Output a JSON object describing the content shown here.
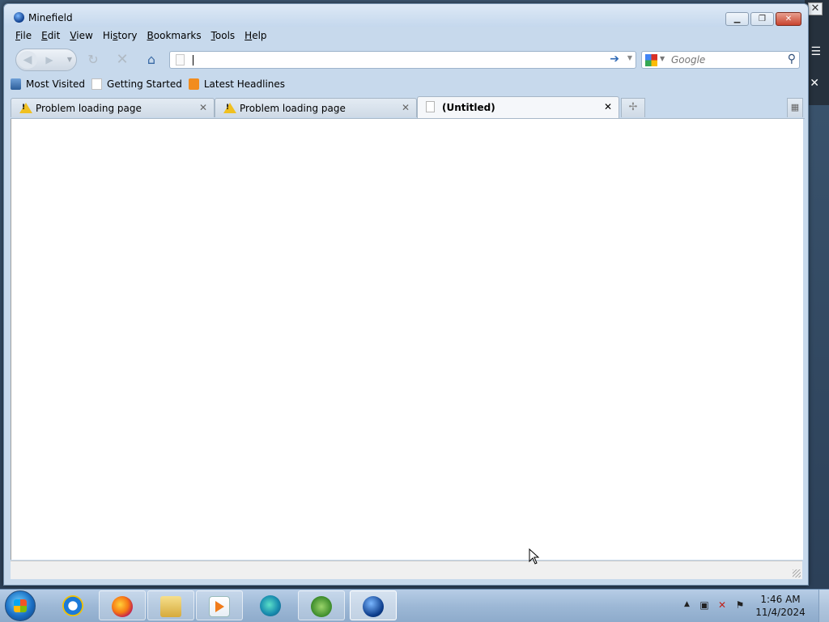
{
  "window": {
    "title": "Minefield"
  },
  "menu": [
    "File",
    "Edit",
    "View",
    "History",
    "Bookmarks",
    "Tools",
    "Help"
  ],
  "menu_access_keys": [
    "F",
    "E",
    "V",
    "H",
    "B",
    "T",
    "H"
  ],
  "navigation": {
    "url_value": "",
    "search_placeholder": "Google"
  },
  "bookmarks": [
    {
      "label": "Most Visited",
      "icon": "most-visited-icon"
    },
    {
      "label": "Getting Started",
      "icon": "page-icon"
    },
    {
      "label": "Latest Headlines",
      "icon": "rss-feed-icon"
    }
  ],
  "tabs": [
    {
      "label": "Problem loading page",
      "icon": "warning-icon",
      "active": false
    },
    {
      "label": "Problem loading page",
      "icon": "warning-icon",
      "active": false
    },
    {
      "label": "(Untitled)",
      "icon": "page-icon",
      "active": true
    }
  ],
  "taskbar": {
    "apps": [
      {
        "name": "internet-explorer",
        "icon": "ie-icon"
      },
      {
        "name": "firefox",
        "icon": "firefox-icon"
      },
      {
        "name": "file-explorer",
        "icon": "folder-icon"
      },
      {
        "name": "media-player",
        "icon": "media-player-icon"
      },
      {
        "name": "edge",
        "icon": "edge-icon"
      },
      {
        "name": "windows",
        "icon": "windows-icon"
      },
      {
        "name": "minefield",
        "icon": "minefield-icon"
      }
    ],
    "clock_time": "1:46 AM",
    "clock_date": "11/4/2024"
  },
  "colors": {
    "titlebar": "#dde9f6",
    "taskbar": "#9db8d6",
    "warning": "#f0c020",
    "link_blue": "#2f6ab5"
  }
}
